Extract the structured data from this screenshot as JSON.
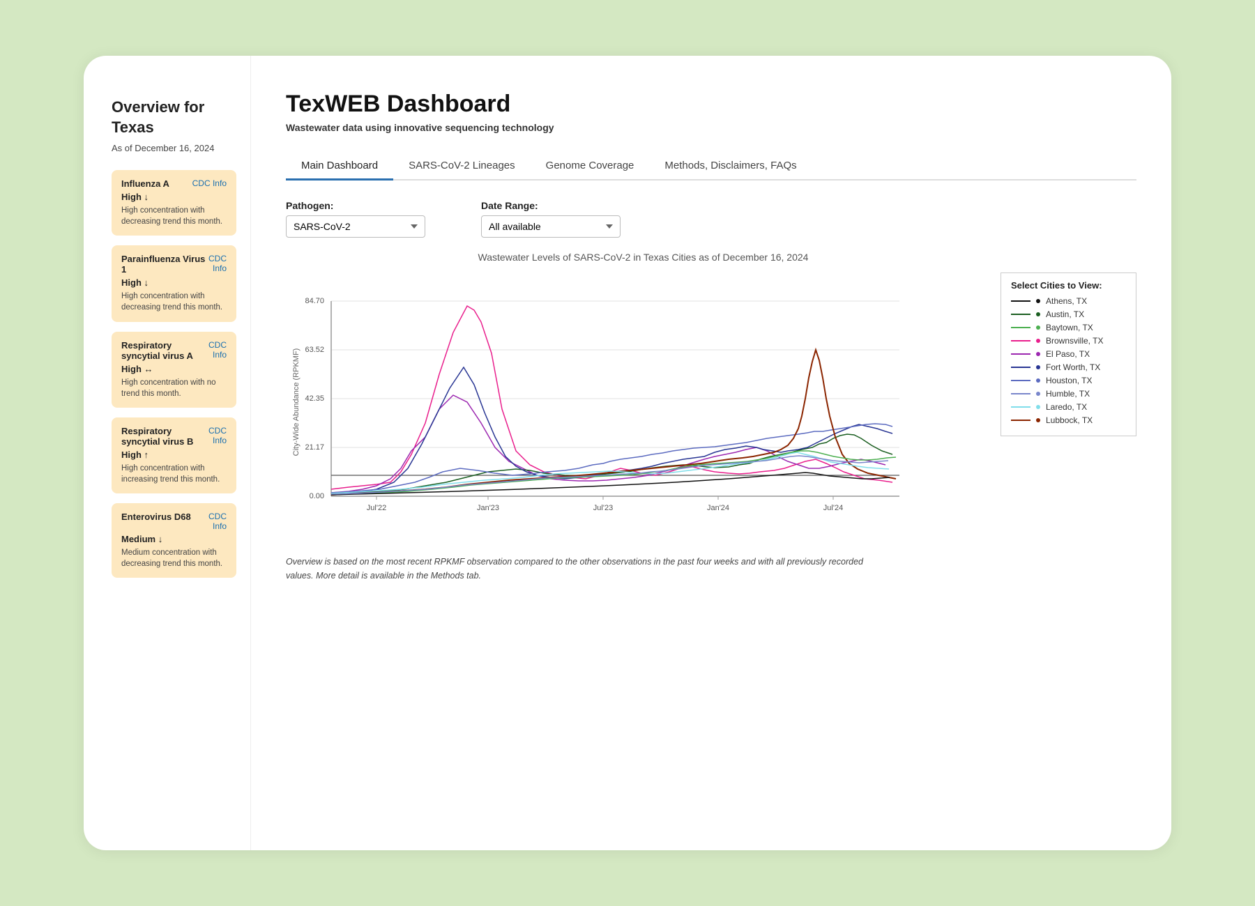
{
  "sidebar": {
    "title": "Overview for Texas",
    "date": "As of December 16, 2024",
    "pathogens": [
      {
        "name": "Influenza A",
        "cdc_link": "CDC Info",
        "level": "High ↓",
        "description": "High concentration with decreasing trend this month.",
        "level_color": "#b45309"
      },
      {
        "name": "Parainfluenza Virus 1",
        "cdc_link": "CDC\nInfo",
        "level": "High ↓",
        "description": "High concentration with decreasing trend this month.",
        "level_color": "#b45309"
      },
      {
        "name": "Respiratory syncytial virus A",
        "cdc_link": "CDC\nInfo",
        "level": "High ↔",
        "description": "High concentration with no trend this month.",
        "level_color": "#b45309"
      },
      {
        "name": "Respiratory syncytial virus B",
        "cdc_link": "CDC\nInfo",
        "level": "High ↑",
        "description": "High concentration with increasing trend this month.",
        "level_color": "#b45309"
      },
      {
        "name": "Enterovirus D68",
        "cdc_link": "CDC\nInfo",
        "level": "Medium ↓",
        "description": "Medium concentration with decreasing trend this month.",
        "level_color": "#92400e"
      }
    ]
  },
  "main": {
    "title": "TexWEB Dashboard",
    "subtitle": "Wastewater data using innovative sequencing technology",
    "tabs": [
      {
        "label": "Main Dashboard",
        "active": true
      },
      {
        "label": "SARS-CoV-2 Lineages",
        "active": false
      },
      {
        "label": "Genome Coverage",
        "active": false
      },
      {
        "label": "Methods, Disclaimers, FAQs",
        "active": false
      }
    ],
    "pathogen_label": "Pathogen:",
    "pathogen_value": "SARS-CoV-2",
    "date_range_label": "Date Range:",
    "date_range_value": "All available",
    "chart_title": "Wastewater Levels of SARS-CoV-2 in Texas Cities as of December 16, 2024",
    "y_axis_label": "City-Wide Abundance (RPKMF)",
    "y_ticks": [
      "84.70",
      "63.52",
      "42.35",
      "21.17",
      "0.00"
    ],
    "x_ticks": [
      "Jul'22",
      "Jan'23",
      "Jul'23",
      "Jan'24",
      "Jul'24"
    ],
    "legend_title": "Select Cities to View:",
    "cities": [
      {
        "name": "Athens, TX",
        "color": "#111111"
      },
      {
        "name": "Austin, TX",
        "color": "#1a5e20"
      },
      {
        "name": "Baytown, TX",
        "color": "#4caf50"
      },
      {
        "name": "Brownsville, TX",
        "color": "#e91e8c"
      },
      {
        "name": "El Paso, TX",
        "color": "#9c27b0"
      },
      {
        "name": "Fort Worth, TX",
        "color": "#283593"
      },
      {
        "name": "Houston, TX",
        "color": "#5c6bc0"
      },
      {
        "name": "Humble, TX",
        "color": "#7986cb"
      },
      {
        "name": "Laredo, TX",
        "color": "#80deea"
      },
      {
        "name": "Lubbock, TX",
        "color": "#8B2500"
      }
    ],
    "footer_note": "Overview is based on the most recent RPKMF observation compared to the other observations in the past four weeks and with all previously recorded values. More detail is available in the Methods tab."
  }
}
